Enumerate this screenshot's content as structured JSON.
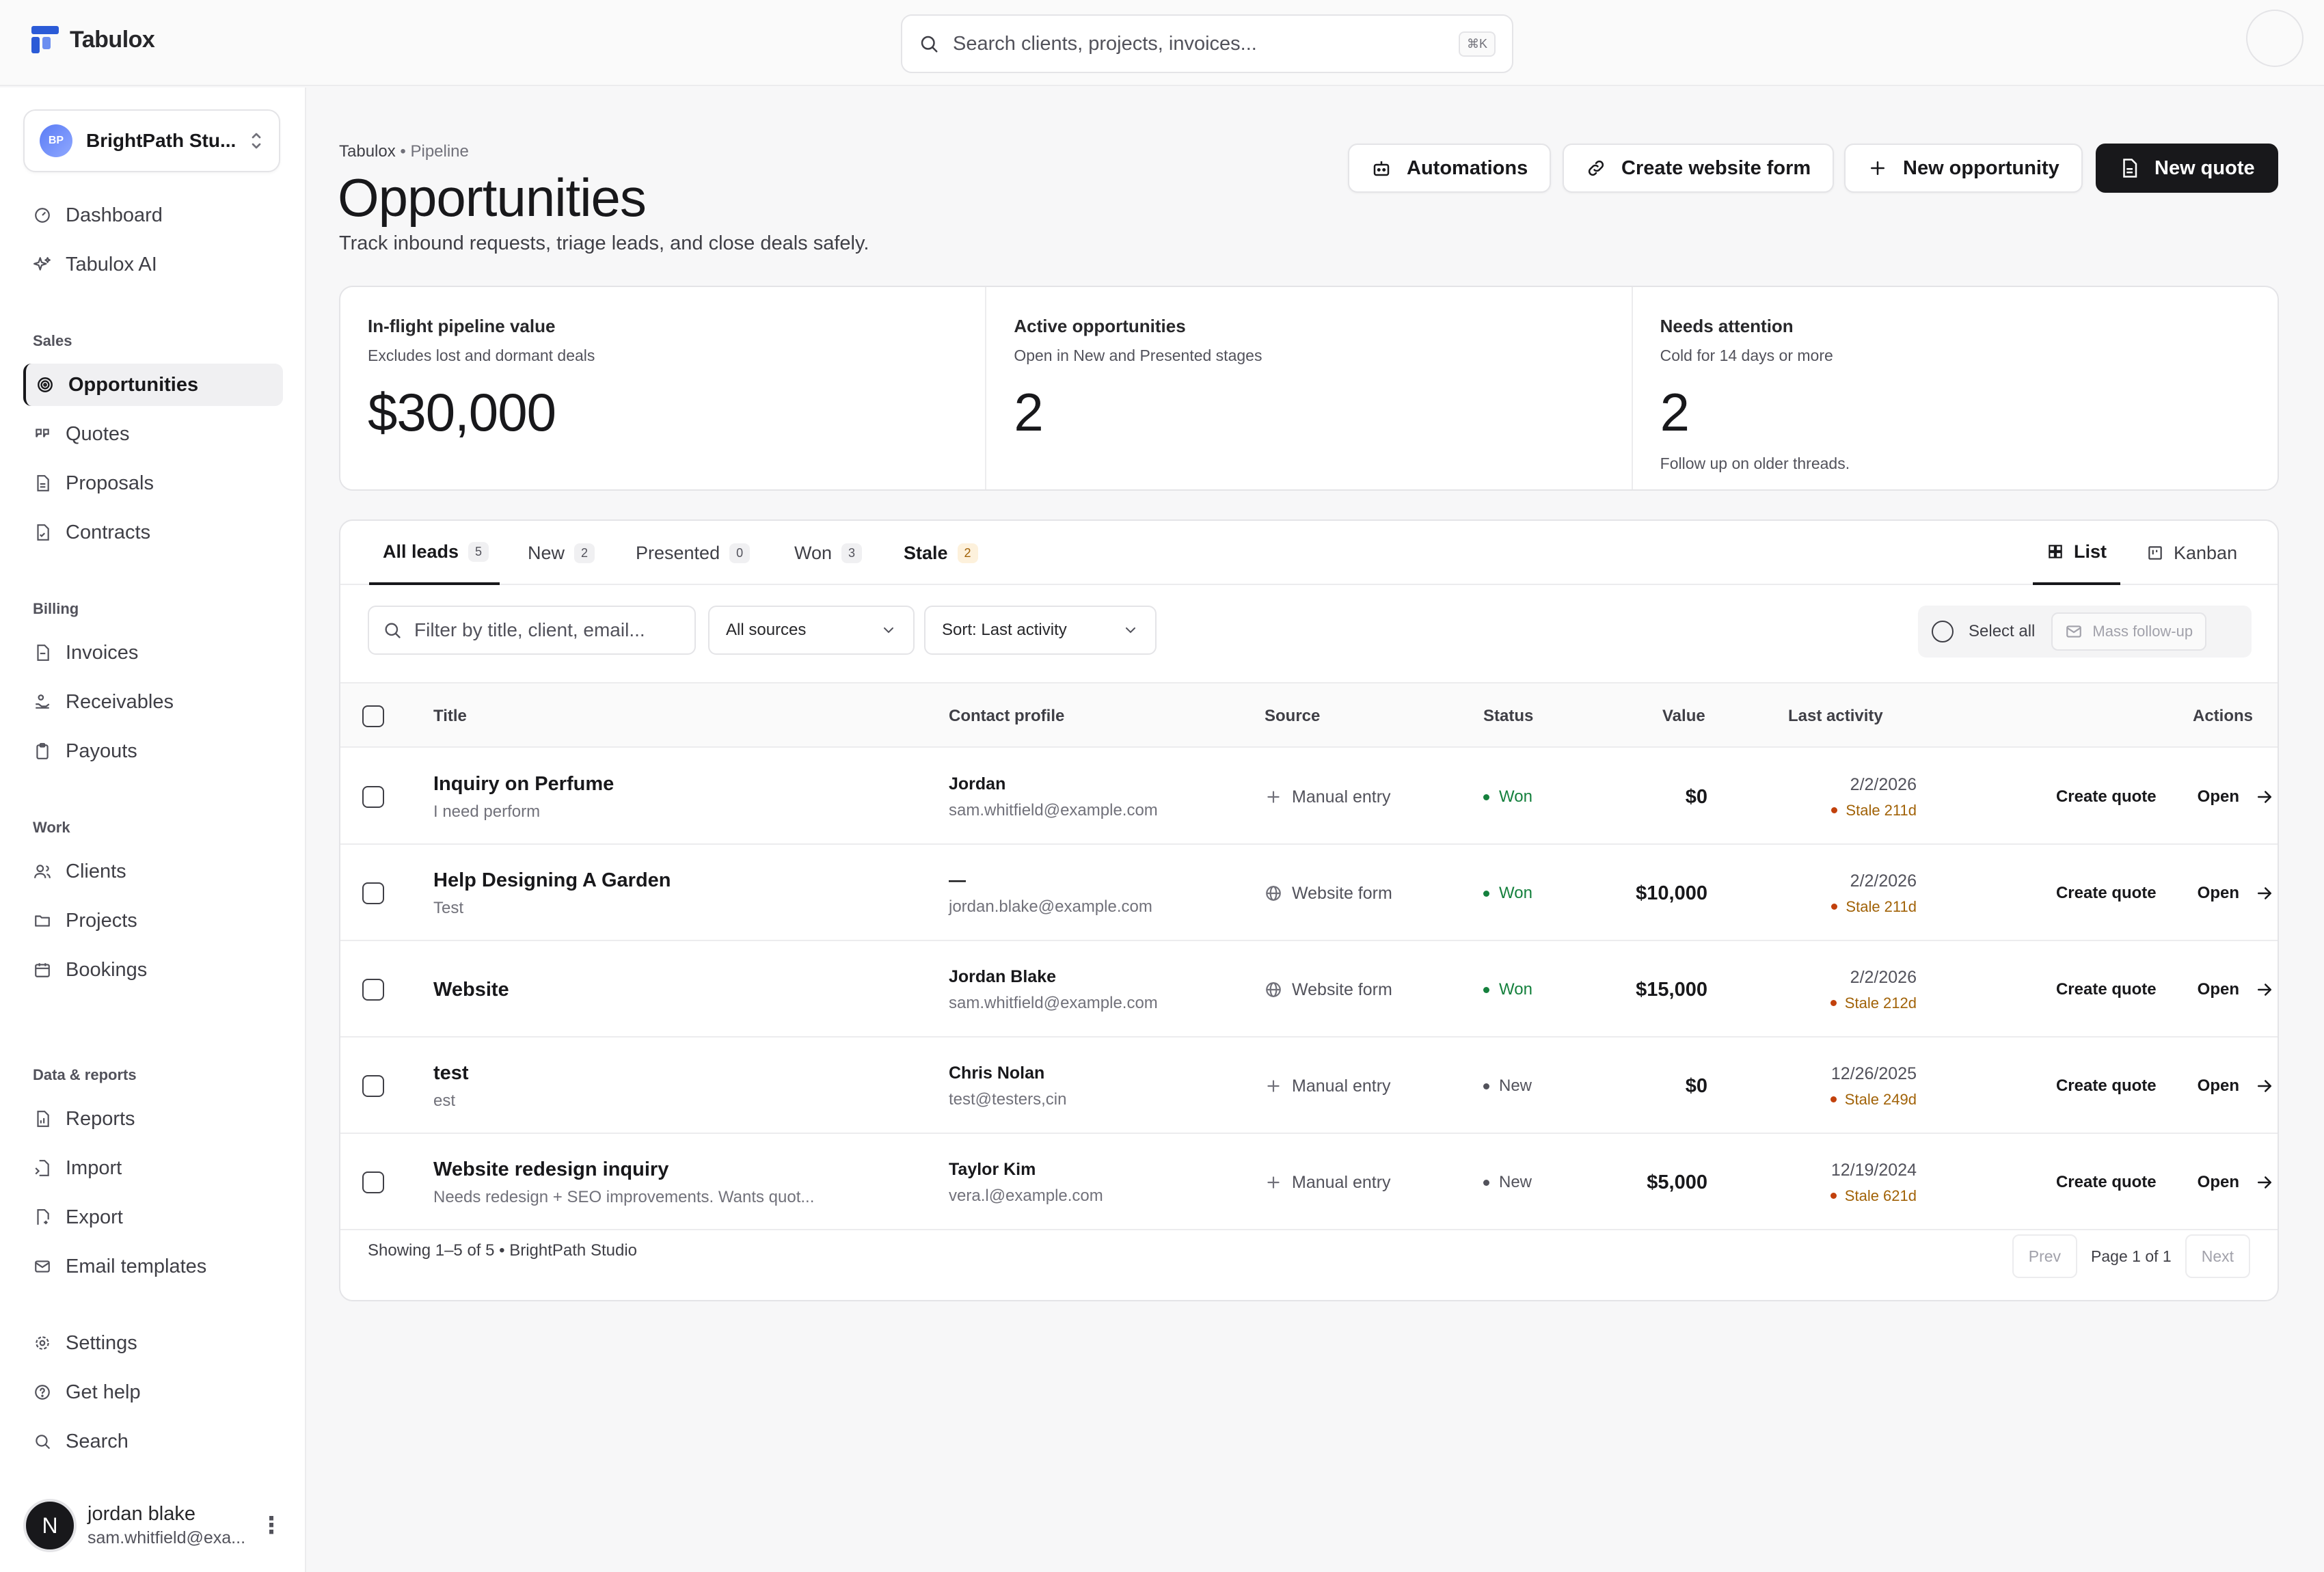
{
  "app": {
    "name": "Tabulox"
  },
  "search": {
    "placeholder": "Search clients, projects, invoices...",
    "shortcut": "⌘K"
  },
  "workspace": {
    "initials": "BP",
    "name": "BrightPath Stu..."
  },
  "sidebar": {
    "top": [
      {
        "label": "Dashboard",
        "icon": "dashboard-icon"
      },
      {
        "label": "Tabulox AI",
        "icon": "sparkles-icon"
      }
    ],
    "sales_label": "Sales",
    "sales": [
      {
        "label": "Opportunities",
        "icon": "target-icon",
        "active": true
      },
      {
        "label": "Quotes",
        "icon": "quote-icon"
      },
      {
        "label": "Proposals",
        "icon": "file-icon"
      },
      {
        "label": "Contracts",
        "icon": "file-check-icon"
      }
    ],
    "billing_label": "Billing",
    "billing": [
      {
        "label": "Invoices",
        "icon": "file-icon"
      },
      {
        "label": "Receivables",
        "icon": "hand-coins-icon"
      },
      {
        "label": "Payouts",
        "icon": "clipboard-icon"
      }
    ],
    "work_label": "Work",
    "work": [
      {
        "label": "Clients",
        "icon": "users-icon"
      },
      {
        "label": "Projects",
        "icon": "folder-icon"
      },
      {
        "label": "Bookings",
        "icon": "calendar-icon"
      }
    ],
    "data_label": "Data & reports",
    "data": [
      {
        "label": "Reports",
        "icon": "report-icon"
      },
      {
        "label": "Import",
        "icon": "import-icon"
      },
      {
        "label": "Export",
        "icon": "export-icon"
      },
      {
        "label": "Email templates",
        "icon": "mail-icon"
      }
    ],
    "bottom": [
      {
        "label": "Settings",
        "icon": "gear-icon"
      },
      {
        "label": "Get help",
        "icon": "help-icon"
      },
      {
        "label": "Search",
        "icon": "search-icon"
      }
    ]
  },
  "user": {
    "initial": "N",
    "name": "jordan blake",
    "email": "sam.whitfield@exa..."
  },
  "header": {
    "crumb_root": "Tabulox",
    "crumb_sep": " • ",
    "crumb_page": "Pipeline",
    "title": "Opportunities",
    "description": "Track inbound requests, triage leads, and close deals safely.",
    "buttons": {
      "automations": "Automations",
      "website_form": "Create website form",
      "new_opportunity": "New opportunity",
      "new_quote": "New quote"
    }
  },
  "stats": [
    {
      "label": "In-flight pipeline value",
      "sub": "Excludes lost and dormant deals",
      "value": "$30,000",
      "note": ""
    },
    {
      "label": "Active opportunities",
      "sub": "Open in New and Presented stages",
      "value": "2",
      "note": ""
    },
    {
      "label": "Needs attention",
      "sub": "Cold for 14 days or more",
      "value": "2",
      "note": "Follow up on older threads."
    }
  ],
  "tabs": [
    {
      "label": "All leads",
      "count": "5"
    },
    {
      "label": "New",
      "count": "2"
    },
    {
      "label": "Presented",
      "count": "0"
    },
    {
      "label": "Won",
      "count": "3"
    },
    {
      "label": "Stale",
      "count": "2"
    }
  ],
  "views": {
    "list": "List",
    "kanban": "Kanban"
  },
  "filters": {
    "placeholder": "Filter by title, client, email...",
    "source": "All sources",
    "sort": "Sort: Last activity",
    "select_all": "Select all",
    "mass_follow_up": "Mass follow-up"
  },
  "table": {
    "headers": {
      "title": "Title",
      "contact": "Contact profile",
      "source": "Source",
      "status": "Status",
      "value": "Value",
      "activity": "Last activity",
      "actions": "Actions"
    },
    "create_quote": "Create quote",
    "open": "Open",
    "rows": [
      {
        "title": "Inquiry on Perfume",
        "subtitle": "I need perform",
        "contact_name": "Jordan",
        "contact_email": "sam.whitfield@example.com",
        "source": "Manual entry",
        "source_icon": "plus-icon",
        "status": "Won",
        "status_color": "#15803d",
        "value": "$0",
        "date": "2/2/2026",
        "stale": "Stale 211d"
      },
      {
        "title": "Help Designing A Garden",
        "subtitle": "Test",
        "contact_name": "—",
        "contact_email": "jordan.blake@example.com",
        "source": "Website form",
        "source_icon": "globe-icon",
        "status": "Won",
        "status_color": "#15803d",
        "value": "$10,000",
        "date": "2/2/2026",
        "stale": "Stale 211d"
      },
      {
        "title": "Website",
        "subtitle": "",
        "contact_name": "Jordan Blake",
        "contact_email": "sam.whitfield@example.com",
        "source": "Website form",
        "source_icon": "globe-icon",
        "status": "Won",
        "status_color": "#15803d",
        "value": "$15,000",
        "date": "2/2/2026",
        "stale": "Stale 212d"
      },
      {
        "title": "test",
        "subtitle": "est",
        "contact_name": "Chris Nolan",
        "contact_email": "test@testers,cin",
        "source": "Manual entry",
        "source_icon": "plus-icon",
        "status": "New",
        "status_color": "#52525b",
        "value": "$0",
        "date": "12/26/2025",
        "stale": "Stale 249d"
      },
      {
        "title": "Website redesign inquiry",
        "subtitle": "Needs redesign + SEO improvements. Wants quot...",
        "contact_name": "Taylor Kim",
        "contact_email": "vera.l@example.com",
        "source": "Manual entry",
        "source_icon": "plus-icon",
        "status": "New",
        "status_color": "#52525b",
        "value": "$5,000",
        "date": "12/19/2024",
        "stale": "Stale 621d"
      }
    ]
  },
  "footer": {
    "showing": "Showing 1–5 of 5 • BrightPath Studio",
    "prev": "Prev",
    "page": "Page 1 of 1",
    "next": "Next"
  },
  "colors": {
    "accent": "#18181b",
    "brand": "#2b5bd7",
    "won": "#15803d",
    "stale": "#a16207"
  }
}
